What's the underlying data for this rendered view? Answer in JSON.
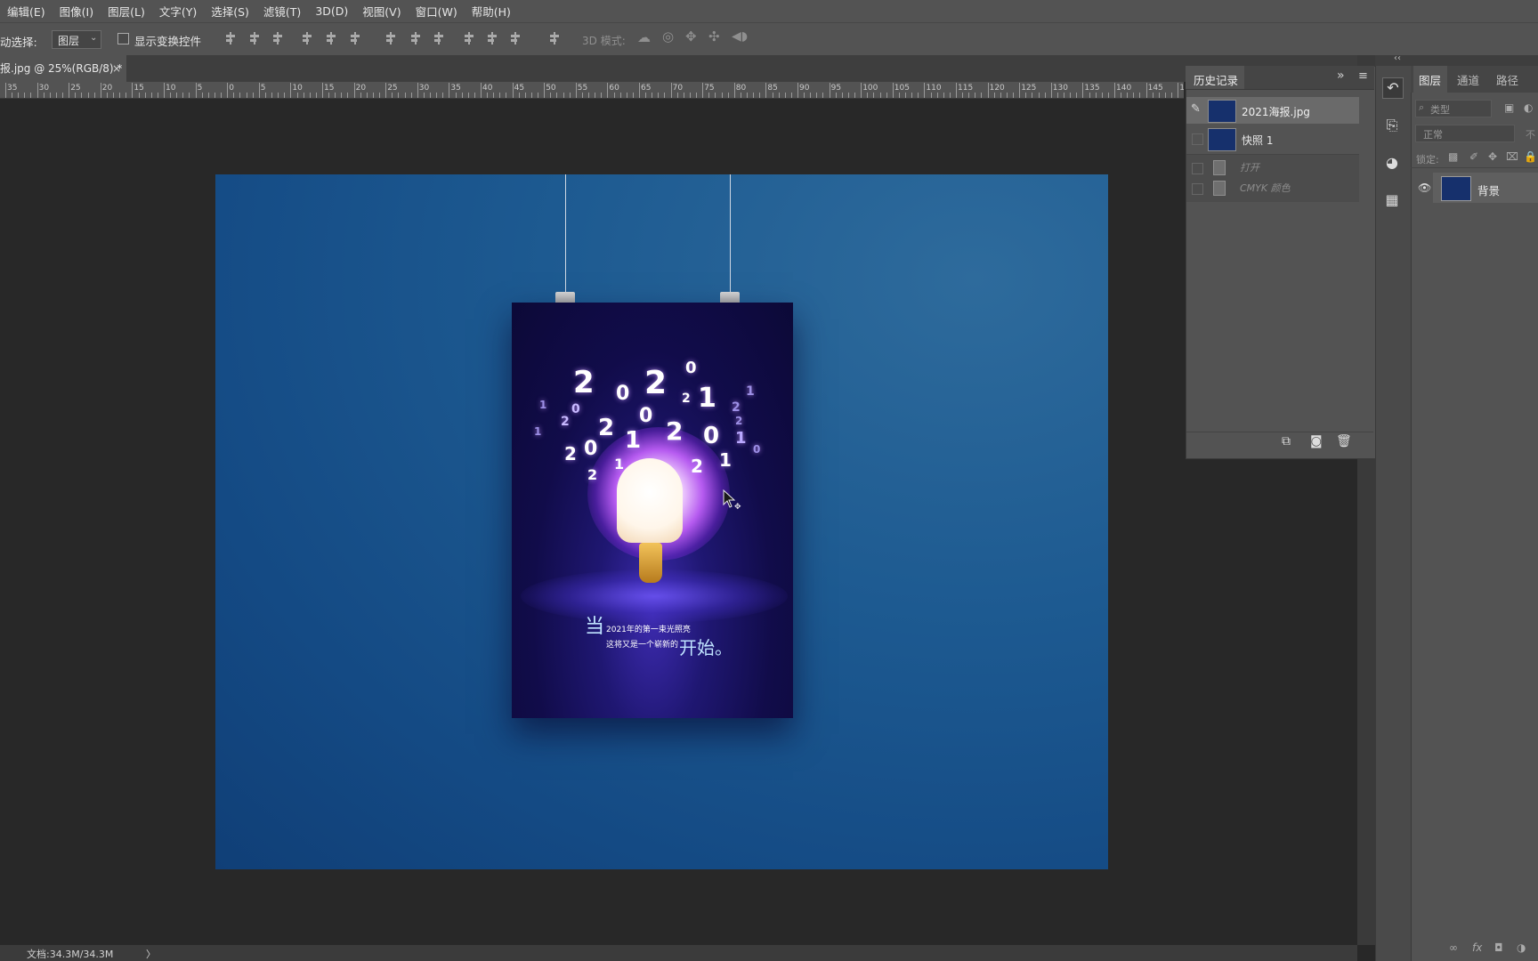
{
  "menu": [
    "编辑(E)",
    "图像(I)",
    "图层(L)",
    "文字(Y)",
    "选择(S)",
    "滤镜(T)",
    "3D(D)",
    "视图(V)",
    "窗口(W)",
    "帮助(H)"
  ],
  "options": {
    "auto_select_label": "动选择:",
    "auto_select_value": "图层",
    "show_transform_label": "显示变换控件",
    "mode3d_label": "3D 模式:"
  },
  "document_tab": {
    "title": "报.jpg @ 25%(RGB/8) *",
    "close": "×"
  },
  "ruler_labels": [
    "35",
    "30",
    "25",
    "20",
    "15",
    "10",
    "5",
    "0",
    "5",
    "10",
    "15",
    "20",
    "25",
    "30",
    "35",
    "40",
    "45",
    "50",
    "55",
    "60",
    "65",
    "70",
    "75",
    "80",
    "85",
    "90",
    "95",
    "100",
    "105",
    "110",
    "115",
    "120",
    "125",
    "130",
    "135",
    "140",
    "145",
    "150"
  ],
  "poster": {
    "numbers": [
      "2",
      "0",
      "2",
      "1",
      "0",
      "2",
      "0",
      "2",
      "1",
      "2",
      "0",
      "1",
      "2",
      "0",
      "2",
      "1",
      "2",
      "0",
      "2",
      "1",
      "2",
      "1",
      "2",
      "0",
      "1",
      "1"
    ],
    "line1_big": "当",
    "line1_rest": "2021年的第一束光照亮",
    "line2_rest": "这将又是一个崭新的",
    "line2_big": "开始。"
  },
  "history_panel": {
    "tab_label": "历史记录",
    "items": [
      {
        "label": "2021海报.jpg",
        "type": "snapshot"
      },
      {
        "label": "快照 1",
        "type": "snapshot"
      },
      {
        "label": "打开",
        "type": "step"
      },
      {
        "label": "CMYK 颜色",
        "type": "step"
      }
    ]
  },
  "layers_panel": {
    "tabs": [
      "图层",
      "通道",
      "路径"
    ],
    "filter_placeholder": "类型",
    "blend_mode": "正常",
    "opacity_label": "不",
    "lock_label": "锁定:",
    "layers": [
      {
        "name": "背景"
      }
    ]
  },
  "status_bar": {
    "doc_info": "文档:34.3M/34.3M",
    "arrow": "〉"
  }
}
